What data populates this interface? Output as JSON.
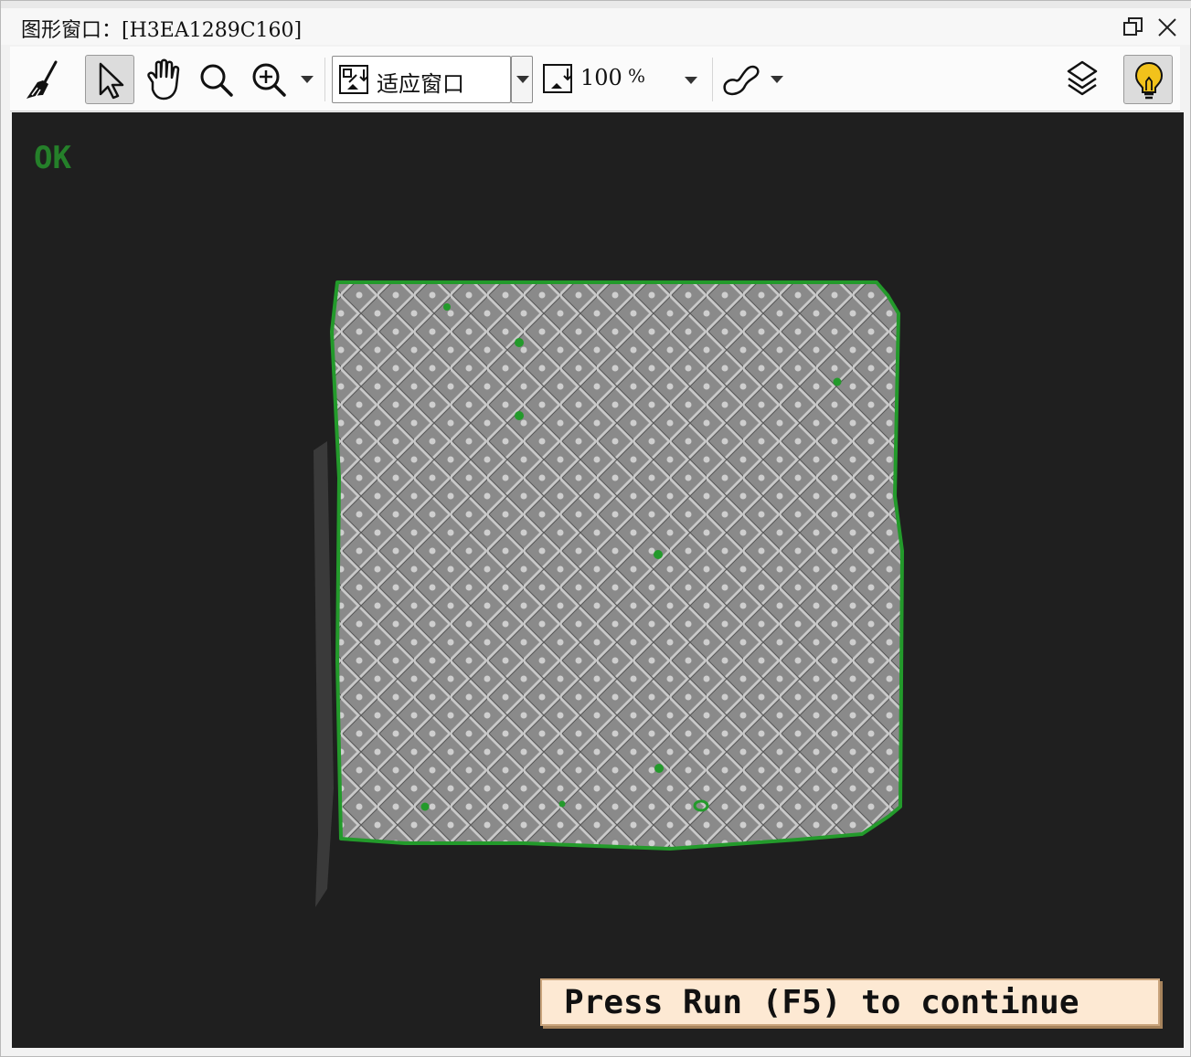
{
  "window": {
    "title": "图形窗口：[H3EA1289C160]"
  },
  "toolbar": {
    "fit_mode_label": "适应窗口",
    "zoom_value": "100",
    "zoom_unit": "%"
  },
  "canvas": {
    "status_text": "OK",
    "hint_text": "Press Run (F5) to continue"
  },
  "colors": {
    "status_green": "#25802a",
    "hint_background": "#fde9d3",
    "canvas_background": "#1f1f1f",
    "bulb_yellow": "#f2c21b"
  }
}
